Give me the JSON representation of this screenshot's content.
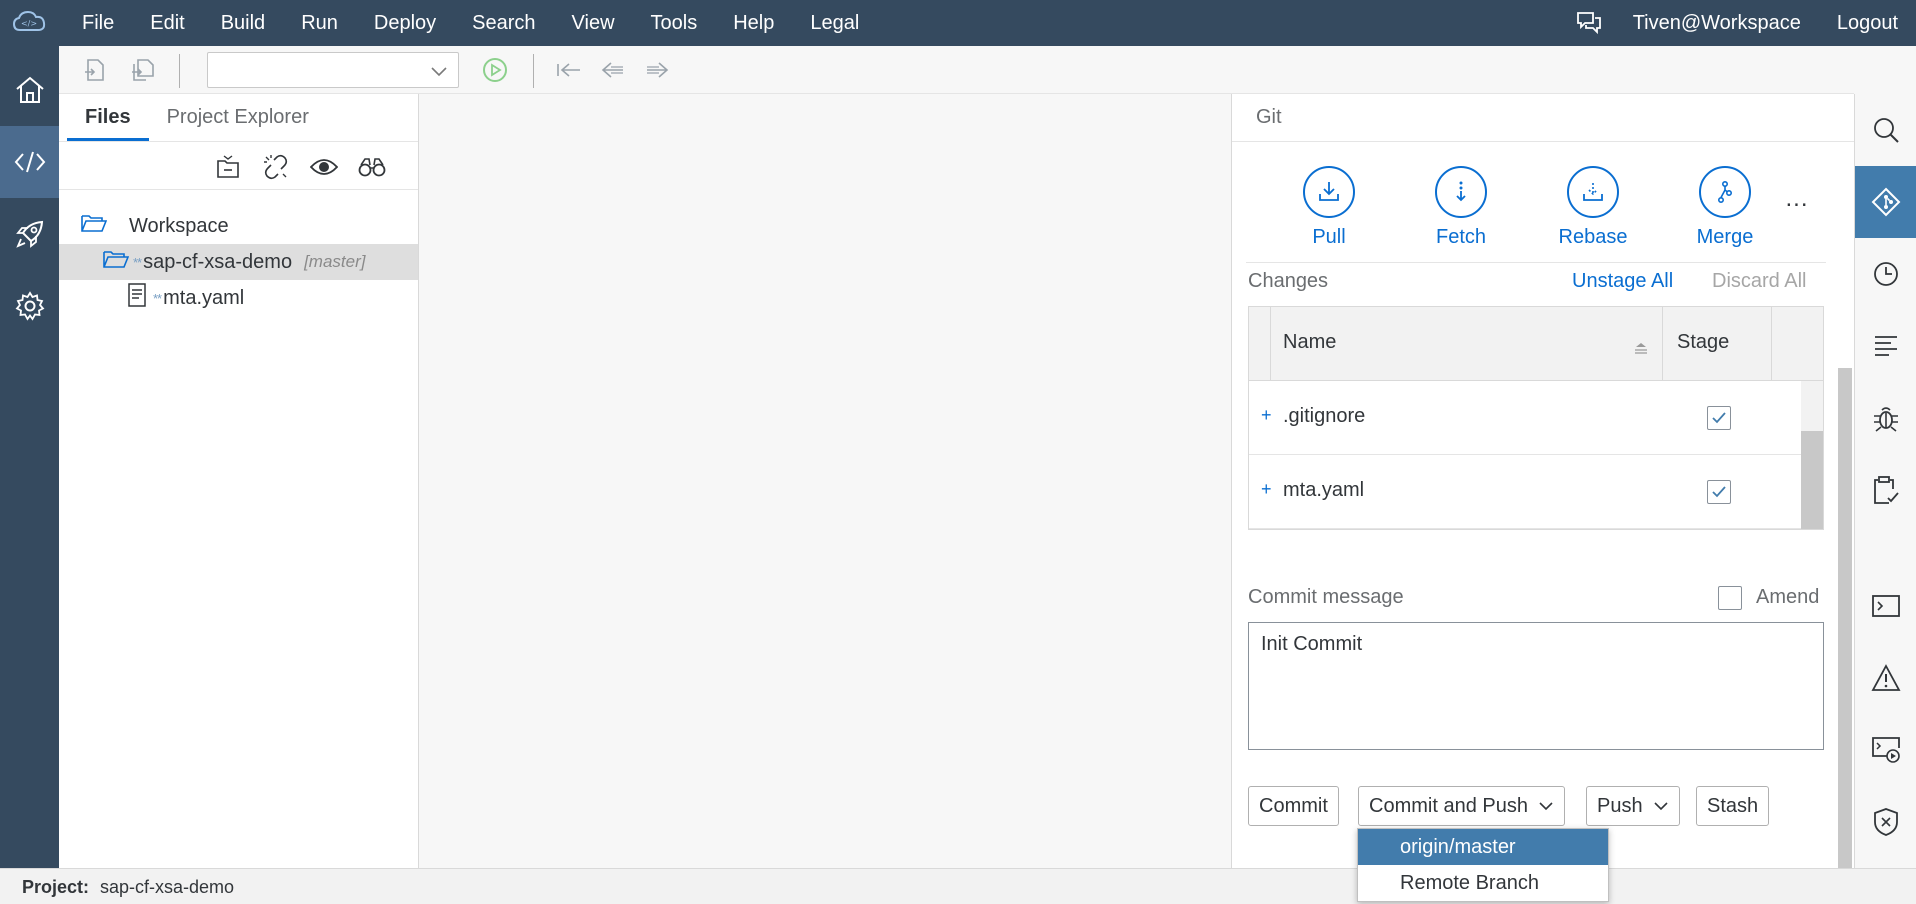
{
  "menubar": {
    "items": [
      "File",
      "Edit",
      "Build",
      "Run",
      "Deploy",
      "Search",
      "View",
      "Tools",
      "Help",
      "Legal"
    ],
    "user": "Tiven@Workspace",
    "logout": "Logout"
  },
  "files_panel": {
    "tabs": [
      "Files",
      "Project Explorer"
    ],
    "tree": {
      "root": "Workspace",
      "project": "sap-cf-xsa-demo",
      "project_branch": "[master]",
      "file": "mta.yaml",
      "marker": "**"
    }
  },
  "git": {
    "title": "Git",
    "actions": [
      "Pull",
      "Fetch",
      "Rebase",
      "Merge"
    ],
    "more": "...",
    "changes_label": "Changes",
    "unstage_all": "Unstage All",
    "discard_all": "Discard All",
    "table": {
      "headers": [
        "Name",
        "Stage"
      ],
      "rows": [
        {
          "status": "+",
          "name": ".gitignore",
          "staged": true
        },
        {
          "status": "+",
          "name": "mta.yaml",
          "staged": true
        }
      ]
    },
    "commit_label": "Commit message",
    "amend_label": "Amend",
    "commit_message": "Init Commit",
    "buttons": {
      "commit": "Commit",
      "commit_and_push": "Commit and Push",
      "push": "Push",
      "stash": "Stash"
    },
    "dropdown": [
      "origin/master",
      "Remote Branch"
    ]
  },
  "statusbar": {
    "label": "Project:",
    "value": "sap-cf-xsa-demo"
  },
  "colors": {
    "shell": "#354a5f",
    "accent": "#0a6ed1",
    "selected": "#427cac"
  }
}
